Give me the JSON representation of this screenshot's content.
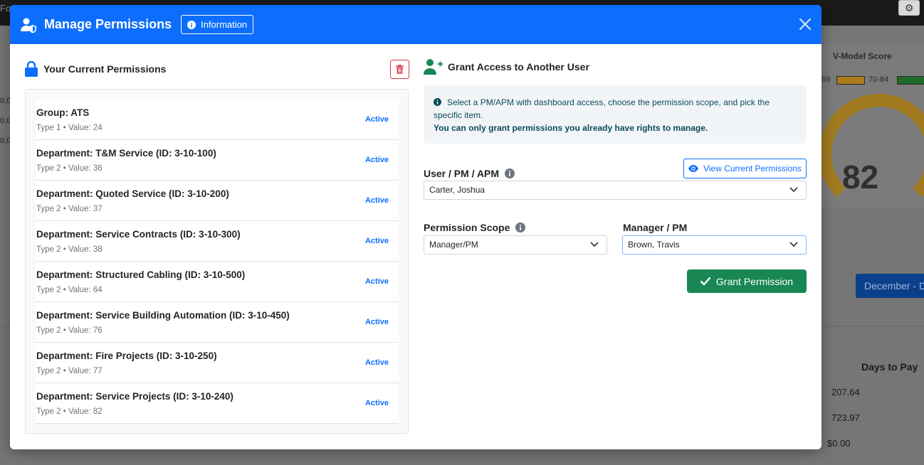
{
  "background": {
    "topbar_text": "Fo",
    "gear_icon": "gear-icon",
    "vmodel_title": "V-Model Score",
    "legend_left": "69",
    "legend_mid": "70-84",
    "score": "82",
    "month_button": "December - D",
    "days_to_pay": "Days to Pay",
    "values": [
      "207.64",
      "723.97",
      "$0.00"
    ],
    "left_numbers": [
      "0,0",
      "0,0",
      "0,0"
    ]
  },
  "modal": {
    "title": "Manage Permissions",
    "info_button": "Information",
    "header_color": "#0d6efd"
  },
  "current": {
    "title": "Your Current Permissions",
    "items": [
      {
        "name": "Group: ATS",
        "sub": "Type 1 • Value: 24",
        "status": "Active"
      },
      {
        "name": "Department: T&M Service (ID: 3-10-100)",
        "sub": "Type 2 • Value: 36",
        "status": "Active"
      },
      {
        "name": "Department: Quoted Service (ID: 3-10-200)",
        "sub": "Type 2 • Value: 37",
        "status": "Active"
      },
      {
        "name": "Department: Service Contracts (ID: 3-10-300)",
        "sub": "Type 2 • Value: 38",
        "status": "Active"
      },
      {
        "name": "Department: Structured Cabling (ID: 3-10-500)",
        "sub": "Type 2 • Value: 64",
        "status": "Active"
      },
      {
        "name": "Department: Service Building Automation (ID: 3-10-450)",
        "sub": "Type 2 • Value: 76",
        "status": "Active"
      },
      {
        "name": "Department: Fire Projects (ID: 3-10-250)",
        "sub": "Type 2 • Value: 77",
        "status": "Active"
      },
      {
        "name": "Department: Service Projects (ID: 3-10-240)",
        "sub": "Type 2 • Value: 82",
        "status": "Active"
      }
    ]
  },
  "grant": {
    "title": "Grant Access to Another User",
    "alert_line1": "Select a PM/APM with dashboard access, choose the permission scope, and pick the specific item.",
    "alert_line2": "You can only grant permissions you already have rights to manage.",
    "user_label": "User / PM / APM",
    "view_button": "View Current Permissions",
    "user_value": "Carter, Joshua",
    "scope_label": "Permission Scope",
    "scope_value": "Manager/PM",
    "manager_label": "Manager / PM",
    "manager_value": "Brown, Travis",
    "grant_button": "Grant Permission",
    "grant_color": "#198754"
  }
}
